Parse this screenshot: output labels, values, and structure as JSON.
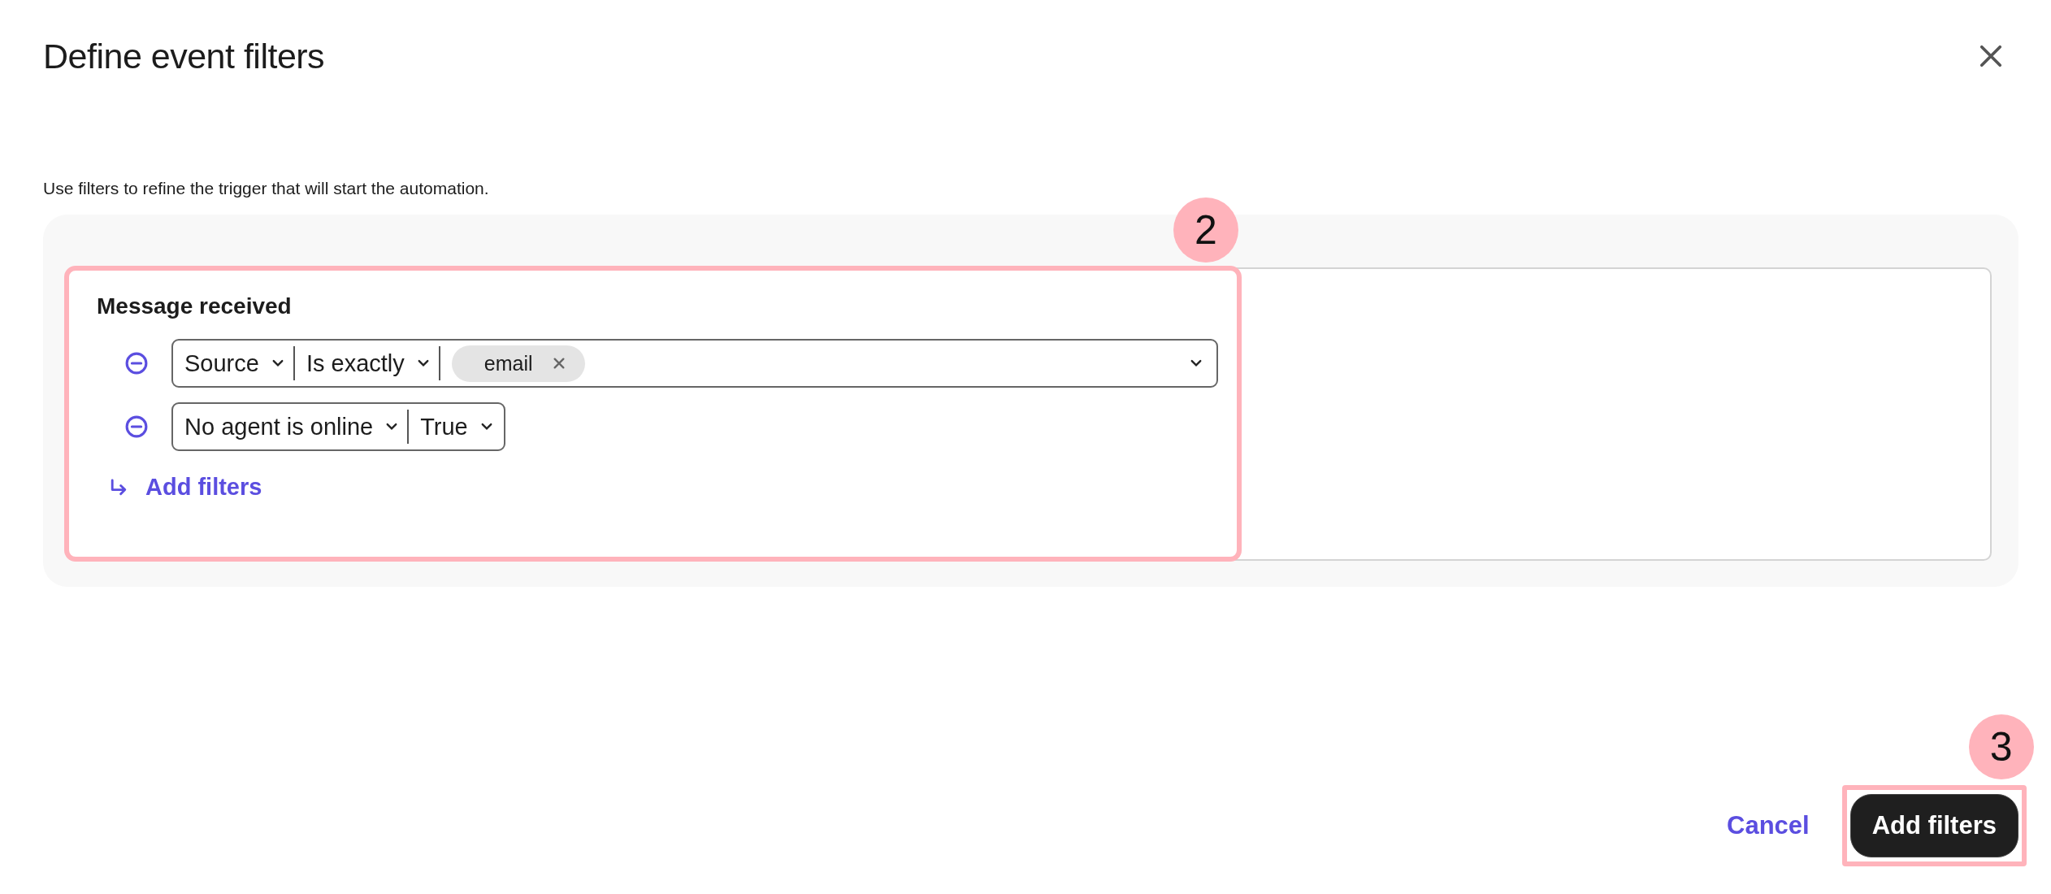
{
  "dialog": {
    "title": "Define event filters",
    "description": "Use filters to refine the trigger that will start the automation."
  },
  "filter_group": {
    "title": "Message received",
    "annotation": "2",
    "rows": [
      {
        "fields": [
          {
            "kind": "select",
            "value": "Source"
          },
          {
            "kind": "select",
            "value": "Is exactly"
          },
          {
            "kind": "tags",
            "tags": [
              "email"
            ]
          }
        ]
      },
      {
        "fields": [
          {
            "kind": "select",
            "value": "No agent is online"
          },
          {
            "kind": "select",
            "value": "True"
          }
        ]
      }
    ],
    "add_label": "Add filters"
  },
  "footer": {
    "cancel": "Cancel",
    "submit": "Add filters",
    "submit_annotation": "3"
  }
}
